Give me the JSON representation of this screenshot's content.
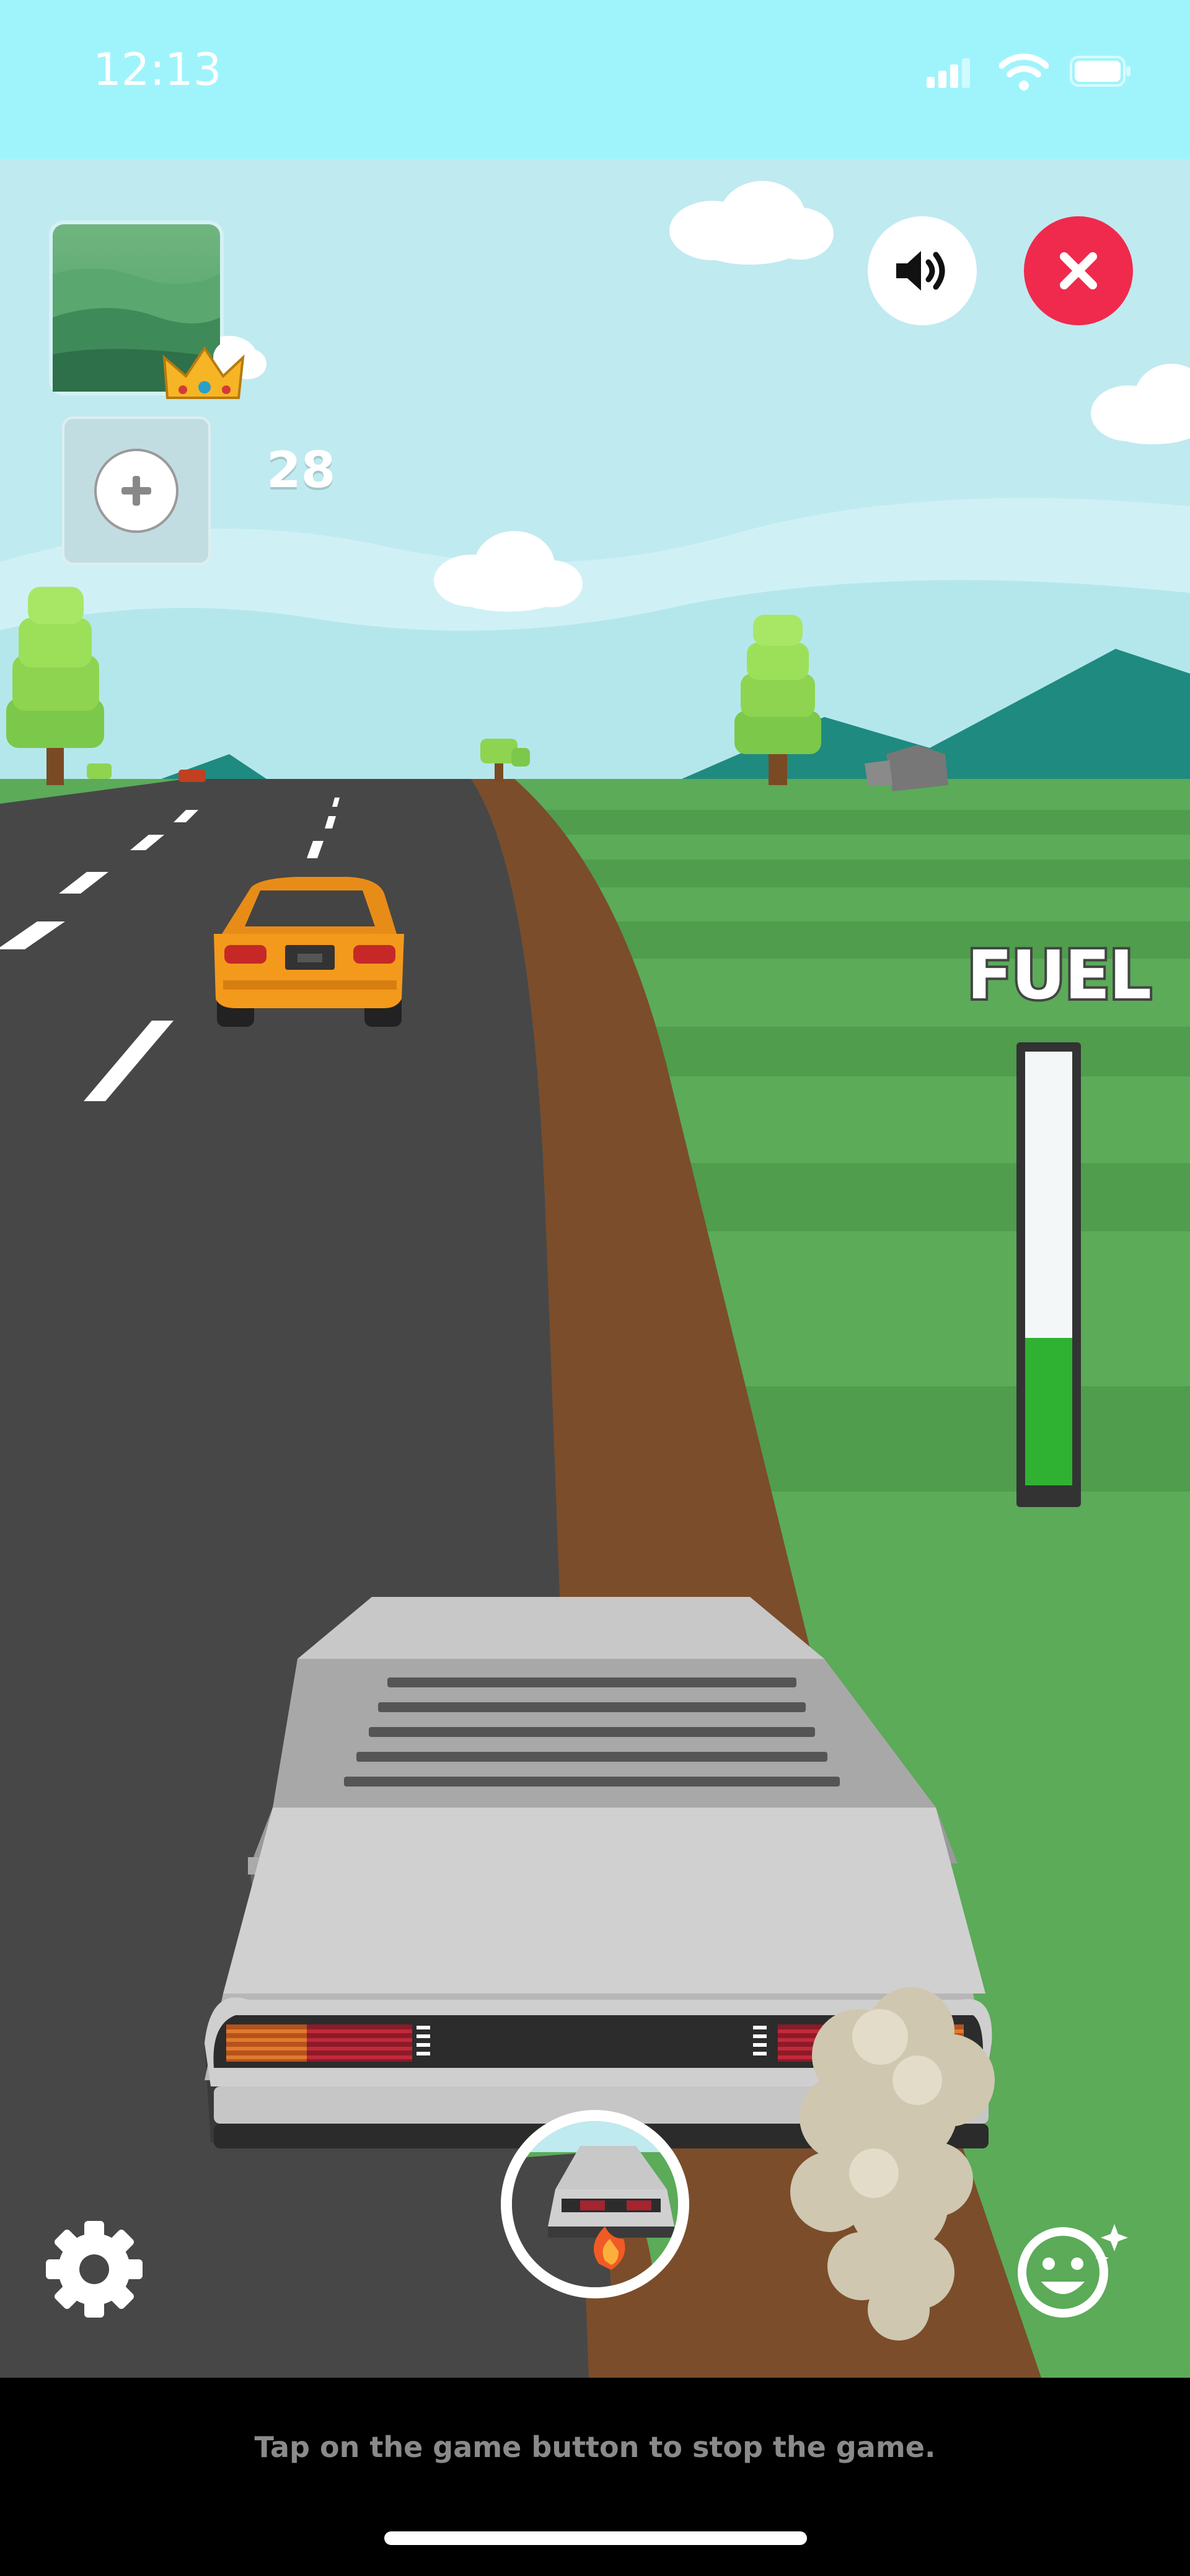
{
  "status_bar": {
    "time": "12:13"
  },
  "hud": {
    "score": "28",
    "fuel_label": "FUEL",
    "fuel_level": 0.34
  },
  "footer": {
    "hint": "Tap on the game button to stop the game."
  },
  "icons": {
    "sound": "speaker-icon",
    "close": "close-icon",
    "add": "plus-icon",
    "settings": "gear-icon",
    "emoji": "smiley-icon",
    "crown": "crown-icon"
  },
  "colors": {
    "sky": "#b9eaf0",
    "road": "#4a4a4a",
    "dirt": "#7a4a2a",
    "grass": "#5fb05c",
    "close_button": "#f02a4c",
    "fuel_fill": "#2fb232"
  }
}
